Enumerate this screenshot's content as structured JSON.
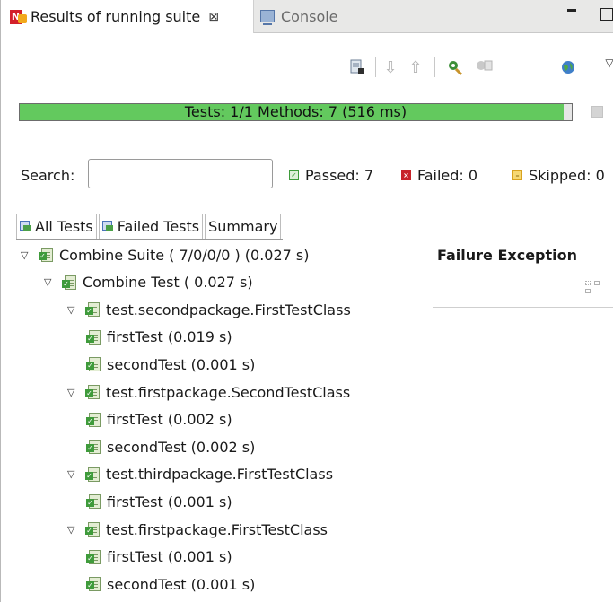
{
  "tabs": {
    "active_label": "Results of running suite",
    "close_glyph": "⊠",
    "console_label": "Console"
  },
  "progress": {
    "text": "Tests: 1/1  Methods: 7 (516 ms)",
    "fraction": 0.985,
    "color": "#63c95e"
  },
  "search": {
    "label": "Search:",
    "value": "",
    "placeholder": ""
  },
  "counters": {
    "passed": "Passed: 7",
    "failed": "Failed: 0",
    "skipped": "Skipped: 0"
  },
  "bottom_tabs": [
    "All Tests",
    "Failed Tests",
    "Summary"
  ],
  "tree": [
    {
      "label": "Combine Suite ( 7/0/0/0 ) (0.027 s)",
      "level": 0,
      "expandable": true
    },
    {
      "label": "Combine Test ( 0.027 s)",
      "level": 1,
      "expandable": true
    },
    {
      "label": "test.secondpackage.FirstTestClass",
      "level": 2,
      "expandable": true
    },
    {
      "label": "firstTest  (0.019 s)",
      "level": 3,
      "expandable": false
    },
    {
      "label": "secondTest  (0.001 s)",
      "level": 3,
      "expandable": false
    },
    {
      "label": "test.firstpackage.SecondTestClass",
      "level": 2,
      "expandable": true
    },
    {
      "label": "firstTest  (0.002 s)",
      "level": 3,
      "expandable": false
    },
    {
      "label": "secondTest  (0.002 s)",
      "level": 3,
      "expandable": false
    },
    {
      "label": "test.thirdpackage.FirstTestClass",
      "level": 2,
      "expandable": true
    },
    {
      "label": "firstTest  (0.001 s)",
      "level": 3,
      "expandable": false
    },
    {
      "label": "test.firstpackage.FirstTestClass",
      "level": 2,
      "expandable": true
    },
    {
      "label": "firstTest  (0.001 s)",
      "level": 3,
      "expandable": false
    },
    {
      "label": "secondTest  (0.001 s)",
      "level": 3,
      "expandable": false
    }
  ],
  "failure_panel": {
    "title": "Failure Exception"
  }
}
